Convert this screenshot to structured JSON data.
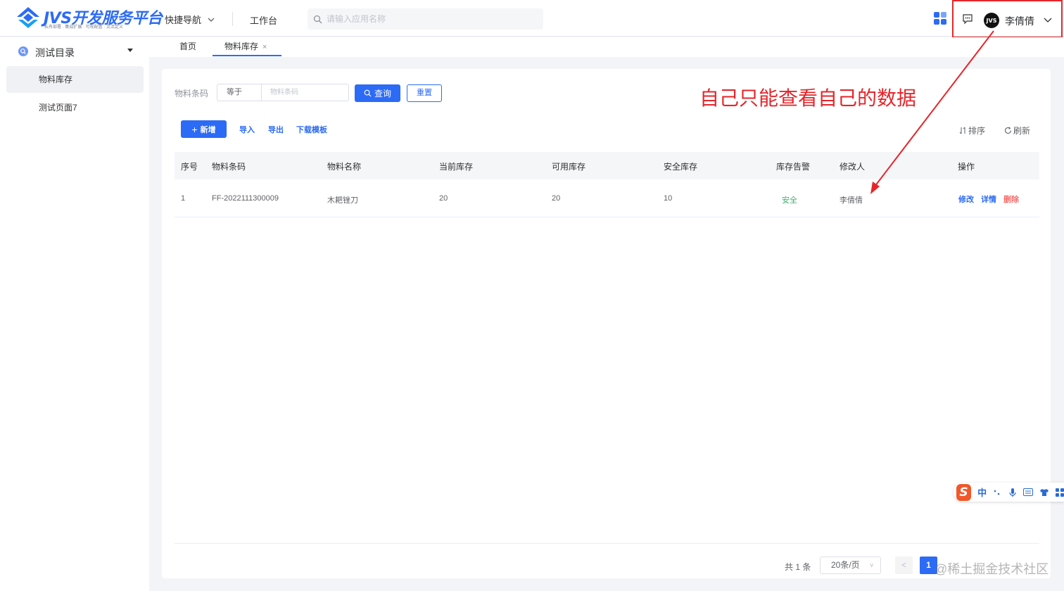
{
  "header": {
    "logo_title": "JVS开发服务平台",
    "logo_subtitle": "私有部署 · 集成扩展 · 可视配置 · 灵活定义",
    "quick_nav_label": "快捷导航",
    "workbench_label": "工作台",
    "search_placeholder": "请输入应用名称",
    "avatar_text": "JVS",
    "username": "李倩倩"
  },
  "sidebar": {
    "group_label": "测试目录",
    "items": [
      {
        "label": "物料库存",
        "active": true
      },
      {
        "label": "测试页面7",
        "active": false
      }
    ]
  },
  "tabs": [
    {
      "label": "首页",
      "active": false
    },
    {
      "label": "物料库存",
      "active": true,
      "close": "×"
    }
  ],
  "filter": {
    "field_label": "物料条码",
    "operator": "等于",
    "input_placeholder": "物料条码",
    "query_label": "查询",
    "reset_label": "重置"
  },
  "toolbar": {
    "add_label": "新增",
    "import_label": "导入",
    "export_label": "导出",
    "template_label": "下载模板",
    "sort_label": "排序",
    "refresh_label": "刷新"
  },
  "annotation": "自己只能查看自己的数据",
  "table": {
    "columns": [
      "序号",
      "物料条码",
      "物料名称",
      "当前库存",
      "可用库存",
      "安全库存",
      "库存告警",
      "修改人",
      "操作"
    ],
    "rows": [
      {
        "index": "1",
        "code": "FF-2022111300009",
        "name": "木耙锉刀",
        "current": "20",
        "available": "20",
        "safety": "10",
        "alert": "安全",
        "modifier": "李倩倩",
        "actions": {
          "edit": "修改",
          "detail": "详情",
          "delete": "删除"
        }
      }
    ]
  },
  "pagination": {
    "total_text": "共 1 条",
    "page_size": "20条/页",
    "prev": "<",
    "current_page": "1"
  },
  "watermark": "@稀土掘金技术社区",
  "ime": {
    "logo": "S",
    "lang": "中"
  },
  "colors": {
    "primary": "#2c6bf5",
    "annotation_red": "#e4262b",
    "safe_green": "#3bb26b",
    "delete_red": "#f56c6c"
  }
}
